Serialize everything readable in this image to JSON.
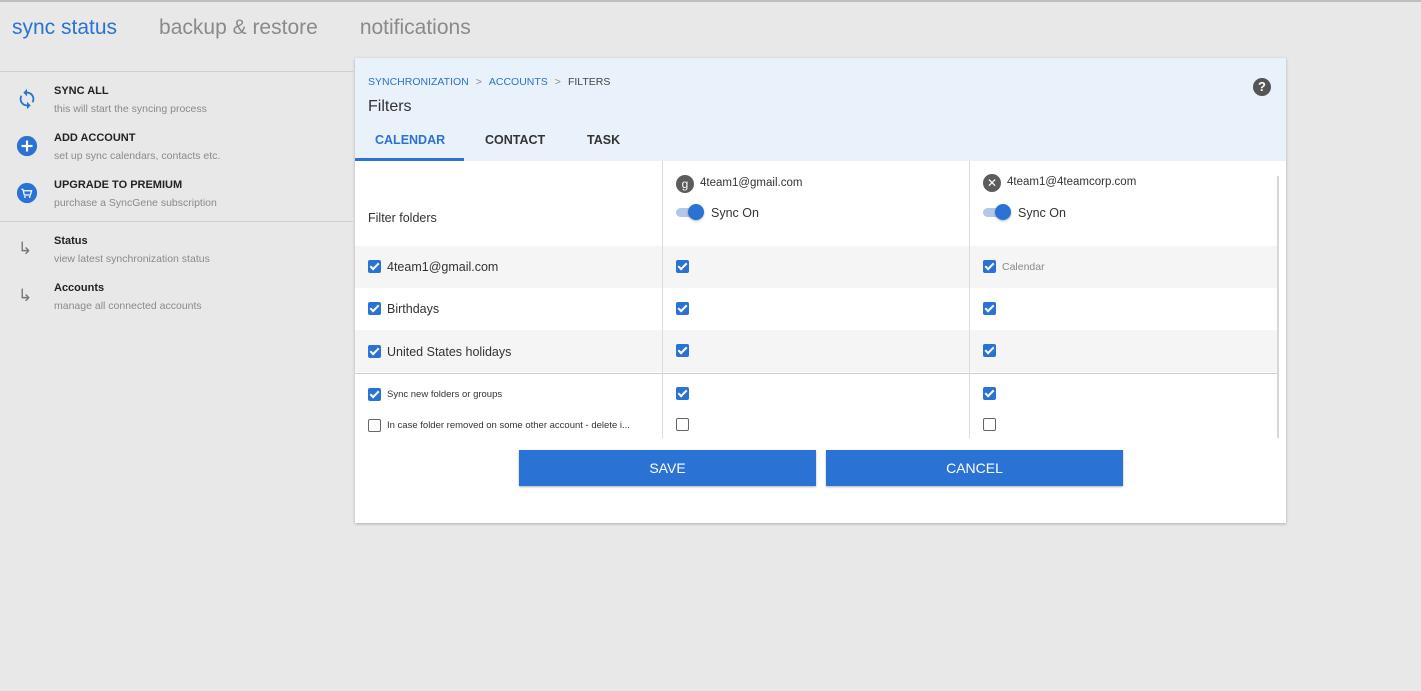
{
  "nav": {
    "tabs": [
      {
        "label": "sync status"
      },
      {
        "label": "backup & restore"
      },
      {
        "label": "notifications"
      }
    ]
  },
  "sidebar": {
    "actions": [
      {
        "title": "SYNC ALL",
        "subtitle": "this will start the syncing process",
        "icon": "sync-icon"
      },
      {
        "title": "ADD ACCOUNT",
        "subtitle": "set up sync calendars, contacts etc.",
        "icon": "add-circle-icon"
      },
      {
        "title": "UPGRADE TO PREMIUM",
        "subtitle": "purchase a SyncGene subscription",
        "icon": "cart-icon"
      }
    ],
    "links": [
      {
        "title": "Status",
        "subtitle": "view latest synchronization status",
        "icon": "subdirectory-arrow-icon"
      },
      {
        "title": "Accounts",
        "subtitle": "manage all connected accounts",
        "icon": "subdirectory-arrow-icon"
      }
    ]
  },
  "panel": {
    "breadcrumb": {
      "first": "SYNCHRONIZATION",
      "second": "ACCOUNTS",
      "current": "FILTERS",
      "separator": ">"
    },
    "title": "Filters",
    "help": "?",
    "tabs": [
      {
        "label": "CALENDAR"
      },
      {
        "label": "CONTACT"
      },
      {
        "label": "TASK"
      }
    ],
    "filter_label": "Filter folders",
    "accounts": [
      {
        "email": "4team1@gmail.com",
        "icon_glyph": "g",
        "icon": "google-icon",
        "toggle_label": "Sync On"
      },
      {
        "email": "4team1@4teamcorp.com",
        "icon_glyph": "✕",
        "icon": "exchange-icon",
        "toggle_label": "Sync On"
      }
    ],
    "folders": [
      {
        "label": "4team1@gmail.com",
        "col1": true,
        "col2": true,
        "col2_label": "Calendar"
      },
      {
        "label": "Birthdays",
        "col1": true,
        "col2": true
      },
      {
        "label": "United States holidays",
        "col1": true,
        "col2": true
      }
    ],
    "options": [
      {
        "label": "Sync new folders or groups",
        "checked": true
      },
      {
        "label": "In case folder removed on some other account - delete i...",
        "checked": false
      }
    ],
    "save_label": "SAVE",
    "cancel_label": "CANCEL"
  },
  "colors": {
    "accent": "#2a72d4",
    "header_bg": "#e9f1fb",
    "page_bg": "#e8e8e8"
  }
}
